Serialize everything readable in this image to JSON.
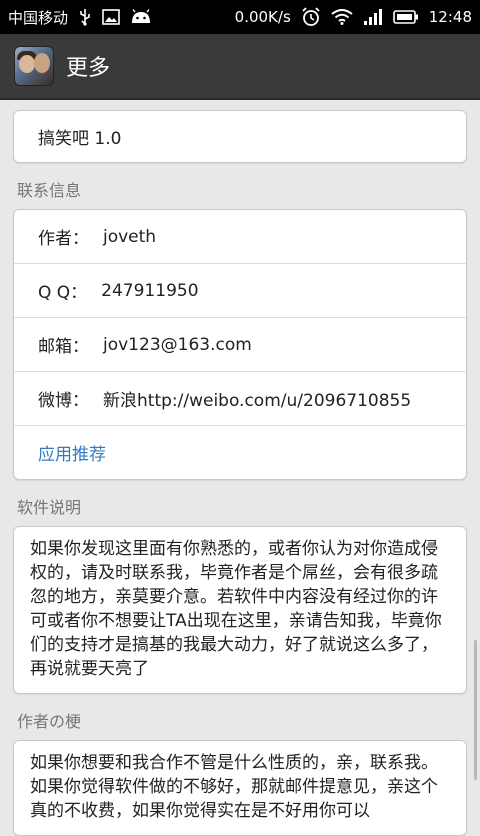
{
  "status_bar": {
    "carrier": "中国移动",
    "speed": "0.00K/s",
    "time": "12:48"
  },
  "action_bar": {
    "title": "更多"
  },
  "app_version": "搞笑吧 1.0",
  "contact": {
    "header": "联系信息",
    "rows": [
      {
        "label": "作者：",
        "value": "joveth"
      },
      {
        "label": "Q Q：",
        "value": "247911950"
      },
      {
        "label": "邮箱：",
        "value": "jov123@163.com"
      },
      {
        "label": "微博：",
        "value": "新浪http://weibo.com/u/2096710855"
      }
    ],
    "recommend_link": "应用推荐"
  },
  "software_desc": {
    "header": "软件说明",
    "text": "如果你发现这里面有你熟悉的，或者你认为对你造成侵权的，请及时联系我，毕竟作者是个屌丝，会有很多疏忽的地方，亲莫要介意。若软件中内容没有经过你的许可或者你不想要让TA出现在这里，亲请告知我，毕竟你们的支持才是搞基的我最大动力，好了就说这么多了，再说就要天亮了"
  },
  "author_note": {
    "header": "作者の梗",
    "text": "如果你想要和我合作不管是什么性质的，亲，联系我。如果你觉得软件做的不够好，那就邮件提意见，亲这个真的不收费，如果你觉得实在是不好用你可以"
  },
  "icons": [
    "usb-icon",
    "picture-icon",
    "android-icon",
    "alarm-icon",
    "wifi-icon",
    "signal-icon",
    "battery-icon"
  ]
}
